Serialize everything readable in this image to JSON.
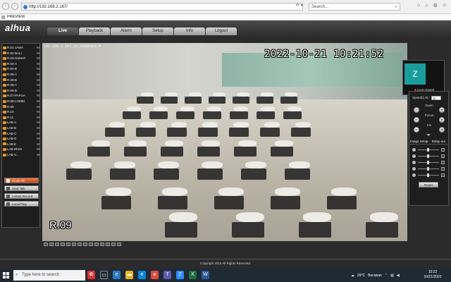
{
  "browser": {
    "url": "http://192.168.2.167/",
    "search_placeholder": "Search...",
    "tab_title": "PREVIEW"
  },
  "app": {
    "logo": "alhua",
    "nav_tabs": [
      {
        "label": "Live",
        "active": true
      },
      {
        "label": "Playback",
        "active": false
      },
      {
        "label": "Alarm",
        "active": false
      },
      {
        "label": "Setup",
        "active": false
      },
      {
        "label": "Info",
        "active": false
      },
      {
        "label": "Logout",
        "active": false
      }
    ],
    "channels": [
      {
        "name": "R.01-JAWA",
        "flag": "M"
      },
      {
        "name": "R.02-BALI",
        "flag": "M"
      },
      {
        "name": "R.03-SUMAT",
        "flag": "M"
      },
      {
        "name": "R.04-A",
        "flag": "M"
      },
      {
        "name": "R.04-B",
        "flag": "M"
      },
      {
        "name": "R.05-A",
        "flag": "M"
      },
      {
        "name": "R.05-B",
        "flag": "M"
      },
      {
        "name": "R.06-A",
        "flag": "M"
      },
      {
        "name": "R.06-B",
        "flag": "M"
      },
      {
        "name": "R.07-PAPUA",
        "flag": "M"
      },
      {
        "name": "R.08-LOMBI",
        "flag": "M"
      },
      {
        "name": "R.09",
        "flag": "M"
      },
      {
        "name": "R.10",
        "flag": "M"
      },
      {
        "name": "R.11",
        "flag": "M"
      },
      {
        "name": "LAB-A",
        "flag": "M"
      },
      {
        "name": "LAB-B",
        "flag": "M"
      },
      {
        "name": "LAB-C",
        "flag": "M"
      },
      {
        "name": "LAB-D",
        "flag": "M"
      },
      {
        "name": "LAB-E",
        "flag": "M"
      },
      {
        "name": "LAB-IRGN",
        "flag": "M"
      },
      {
        "name": "LAB-V...",
        "flag": "M"
      }
    ],
    "side_buttons": {
      "close_all": "Close All",
      "start_talk": "Start Talk",
      "instant_record": "Instant Record",
      "local_play": "Local Play"
    },
    "video": {
      "info": "192.168.2.167_12_5988kbps_M",
      "timestamp": "2022-10-21  10:21:52",
      "room_label": "R.09"
    },
    "zoom_popup": {
      "initial": "Z",
      "label": "zoom baa04"
    },
    "ptz": {
      "speed_label": "Speed(1-8):",
      "speed_value": "5",
      "zoom_label": "Zoom",
      "focus_label": "Focus",
      "iris_label": "Iris",
      "image_setup_tab": "Image Setup",
      "relay_out_tab": "Relay-out",
      "reset_label": "Reset",
      "sliders": [
        {
          "name": "brightness",
          "level": 0.45
        },
        {
          "name": "contrast",
          "level": 0.45
        },
        {
          "name": "saturation",
          "level": 0.45
        },
        {
          "name": "hue",
          "level": 0.45
        },
        {
          "name": "gain",
          "level": 0.45
        }
      ]
    },
    "footer": "Copyright 2015 All Rights Reserved."
  },
  "taskbar": {
    "search_placeholder": "Type here to search",
    "weather_temp": "29°C",
    "weather_text": "Berawan",
    "time": "10:22",
    "date": "10/21/2022"
  },
  "colors": {
    "accent_orange": "#e59a1b",
    "close_all_red": "#d4562a",
    "zoom_teal": "#1a9e9c",
    "taskbar": "#202a34"
  }
}
